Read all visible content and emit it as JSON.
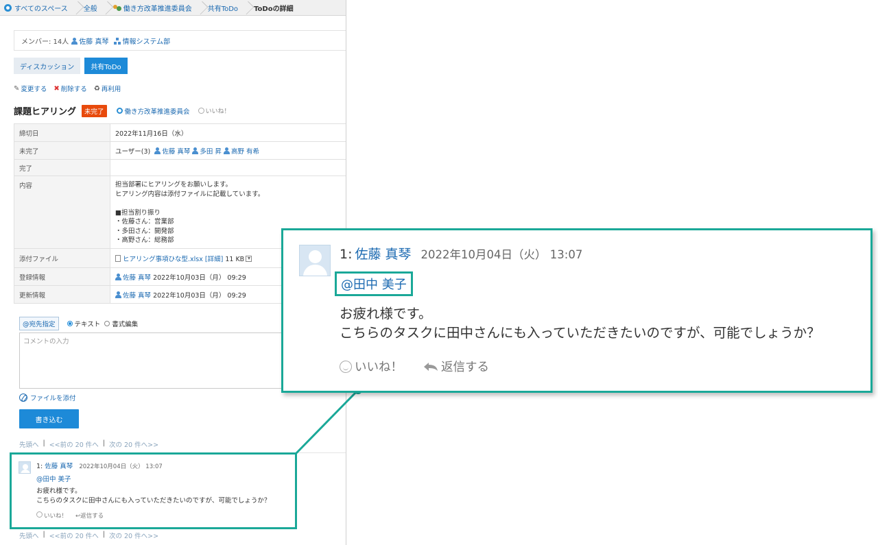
{
  "breadcrumb": {
    "items": [
      "すべてのスペース",
      "全般",
      "働き方改革推進委員会",
      "共有ToDo",
      "ToDoの詳細"
    ]
  },
  "members": {
    "label": "メンバー: 14人",
    "user": "佐藤 真琴",
    "org": "情報システム部"
  },
  "tabs": [
    "ディスカッション",
    "共有ToDo"
  ],
  "actions": {
    "edit": "変更する",
    "delete": "削除する",
    "reuse": "再利用"
  },
  "todo": {
    "title": "課題ヒアリング",
    "status": "未完了",
    "space": "働き方改革推進委員会",
    "like": "いいね！"
  },
  "detail": {
    "due_label": "締切日",
    "due_value": "2022年11月16日（水）",
    "incomplete_label": "未完了",
    "incomplete_count": "ユーザー(3)",
    "incomplete_users": [
      "佐藤 真琴",
      "多田 昇",
      "高野 有希"
    ],
    "complete_label": "完了",
    "content_label": "内容",
    "content_value": "担当部署にヒアリングをお願いします。\nヒアリング内容は添付ファイルに記載しています。\n\n■担当割り振り\n・佐藤さん：営業部\n・多田さん：開発部\n・高野さん：総務部",
    "attach_label": "添付ファイル",
    "attach_file": "ヒアリング事項ひな型.xlsx",
    "attach_detail": "[詳細]",
    "attach_size": "11 KB",
    "registered_label": "登録情報",
    "registered_user": "佐藤 真琴",
    "registered_date": "2022年10月03日（月） 09:29",
    "updated_label": "更新情報",
    "updated_user": "佐藤 真琴",
    "updated_date": "2022年10月03日（月） 09:29"
  },
  "editor": {
    "to_button": "@宛先指定",
    "mode_text": "テキスト",
    "mode_rich": "書式編集",
    "placeholder": "コメントの入力",
    "attach": "ファイルを添付",
    "submit": "書き込む"
  },
  "pager": {
    "first": "先頭へ",
    "prev": "<<前の 20 件へ",
    "next": "次の 20 件へ>>"
  },
  "comment": {
    "number": "1:",
    "author": "佐藤 真琴",
    "date": "2022年10月04日（火） 13:07",
    "mention": "@田中 美子",
    "body": "お疲れ様です。\nこちらのタスクに田中さんにも入っていただきたいのですが、可能でしょうか？",
    "like": "いいね！",
    "reply": "返信する"
  },
  "colors": {
    "accent": "#1d8ad8",
    "highlight": "#1aa898",
    "status": "#e84a0c",
    "link": "#1c6ab1"
  }
}
